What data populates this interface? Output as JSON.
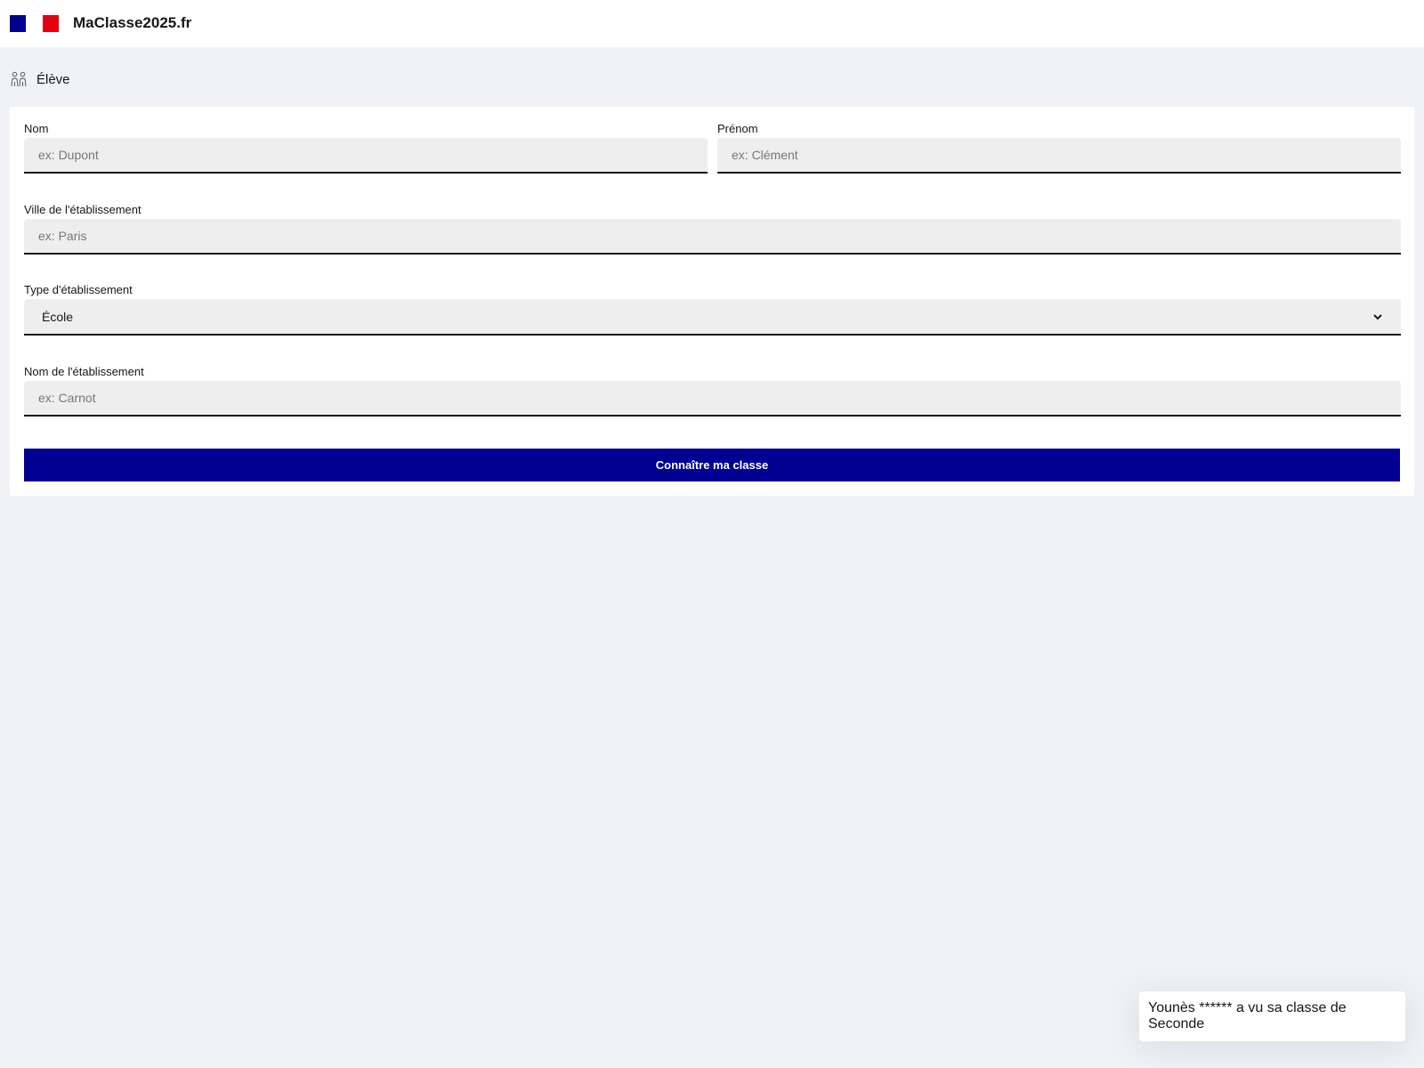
{
  "header": {
    "brand": "MaClasse2025.fr",
    "flag_colors": [
      "#000091",
      "#e1000f"
    ]
  },
  "role": {
    "icon": "people-icon",
    "label": "Élève"
  },
  "form": {
    "nom": {
      "label": "Nom",
      "placeholder": "ex: Dupont"
    },
    "prenom": {
      "label": "Prénom",
      "placeholder": "ex: Clément"
    },
    "ville": {
      "label": "Ville de l'établissement",
      "placeholder": "ex: Paris"
    },
    "type": {
      "label": "Type d'établissement",
      "selected": "École"
    },
    "etablissement": {
      "label": "Nom de l'établissement",
      "placeholder": "ex: Carnot"
    },
    "submit_label": "Connaître ma classe"
  },
  "toast": {
    "text": "Younès ****** a vu sa classe de Seconde"
  },
  "colors": {
    "accent": "#000091",
    "background": "#f1f2f6"
  }
}
